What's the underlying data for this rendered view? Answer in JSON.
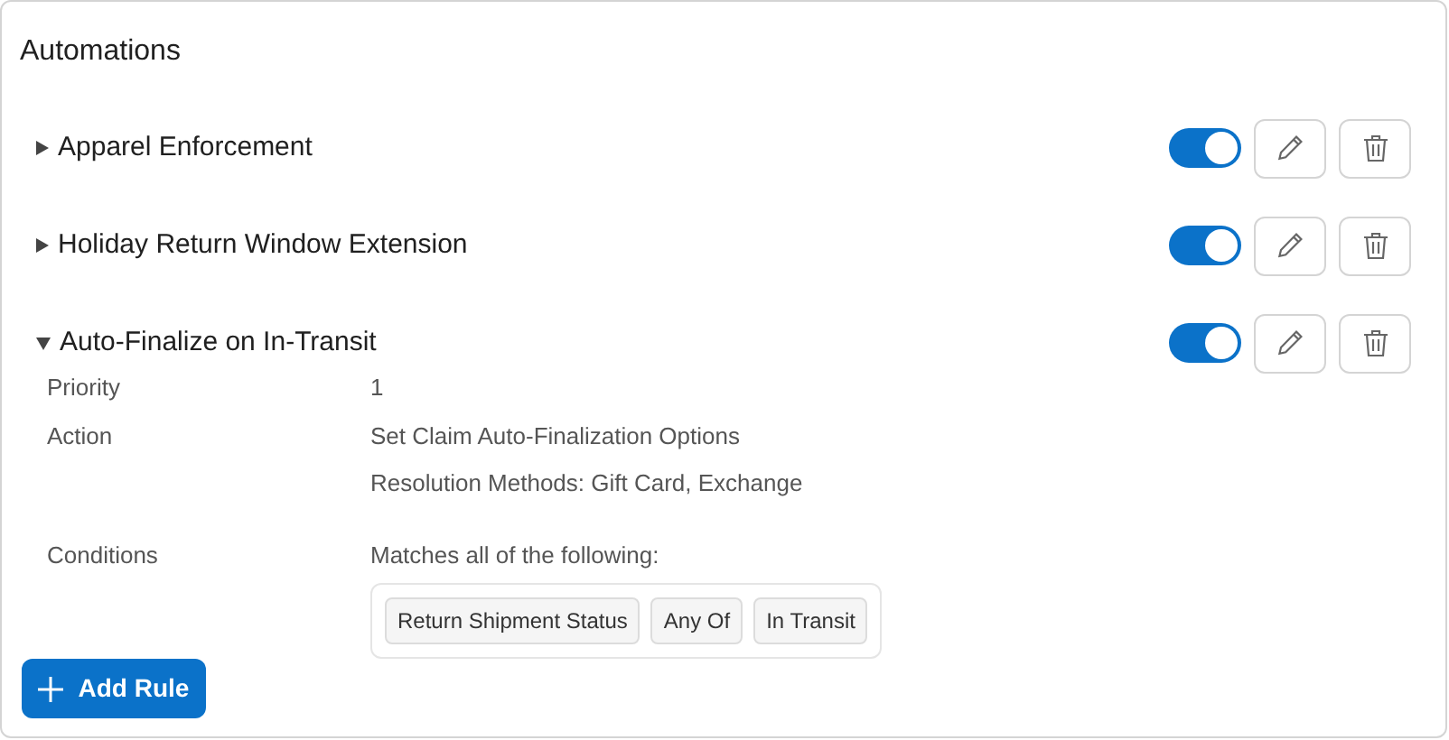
{
  "title": "Automations",
  "rules": [
    {
      "name": "Apparel Enforcement",
      "expanded": false,
      "enabled": true
    },
    {
      "name": "Holiday Return Window Extension",
      "expanded": false,
      "enabled": true
    },
    {
      "name": "Auto-Finalize on In-Transit",
      "expanded": true,
      "enabled": true,
      "details": {
        "priority_label": "Priority",
        "priority": "1",
        "action_label": "Action",
        "action_lines": [
          "Set Claim Auto-Finalization Options",
          "Resolution Methods: Gift Card, Exchange"
        ],
        "conditions_label": "Conditions",
        "conditions_summary": "Matches all of the following:",
        "condition_chips": [
          "Return Shipment Status",
          "Any Of",
          "In Transit"
        ]
      }
    }
  ],
  "add_button": "Add Rule"
}
